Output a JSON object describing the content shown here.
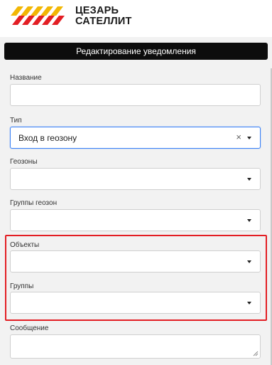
{
  "brand": {
    "line1": "ЦЕЗАРЬ",
    "line2": "САТЕЛЛИТ",
    "logo_icon": "logo-stripes-icon",
    "colors": {
      "yellow": "#f2b705",
      "red": "#e31e24"
    }
  },
  "titlebar": {
    "title": "Редактирование уведомления"
  },
  "form": {
    "name": {
      "label": "Название",
      "value": ""
    },
    "type": {
      "label": "Тип",
      "value": "Вход в геозону",
      "clear_icon": "×"
    },
    "geozones": {
      "label": "Геозоны",
      "value": ""
    },
    "geozone_groups": {
      "label": "Группы геозон",
      "value": ""
    },
    "objects": {
      "label": "Объекты",
      "value": ""
    },
    "groups": {
      "label": "Группы",
      "value": ""
    },
    "message": {
      "label": "Сообщение",
      "value": ""
    }
  },
  "highlight_color": "#e31e24"
}
